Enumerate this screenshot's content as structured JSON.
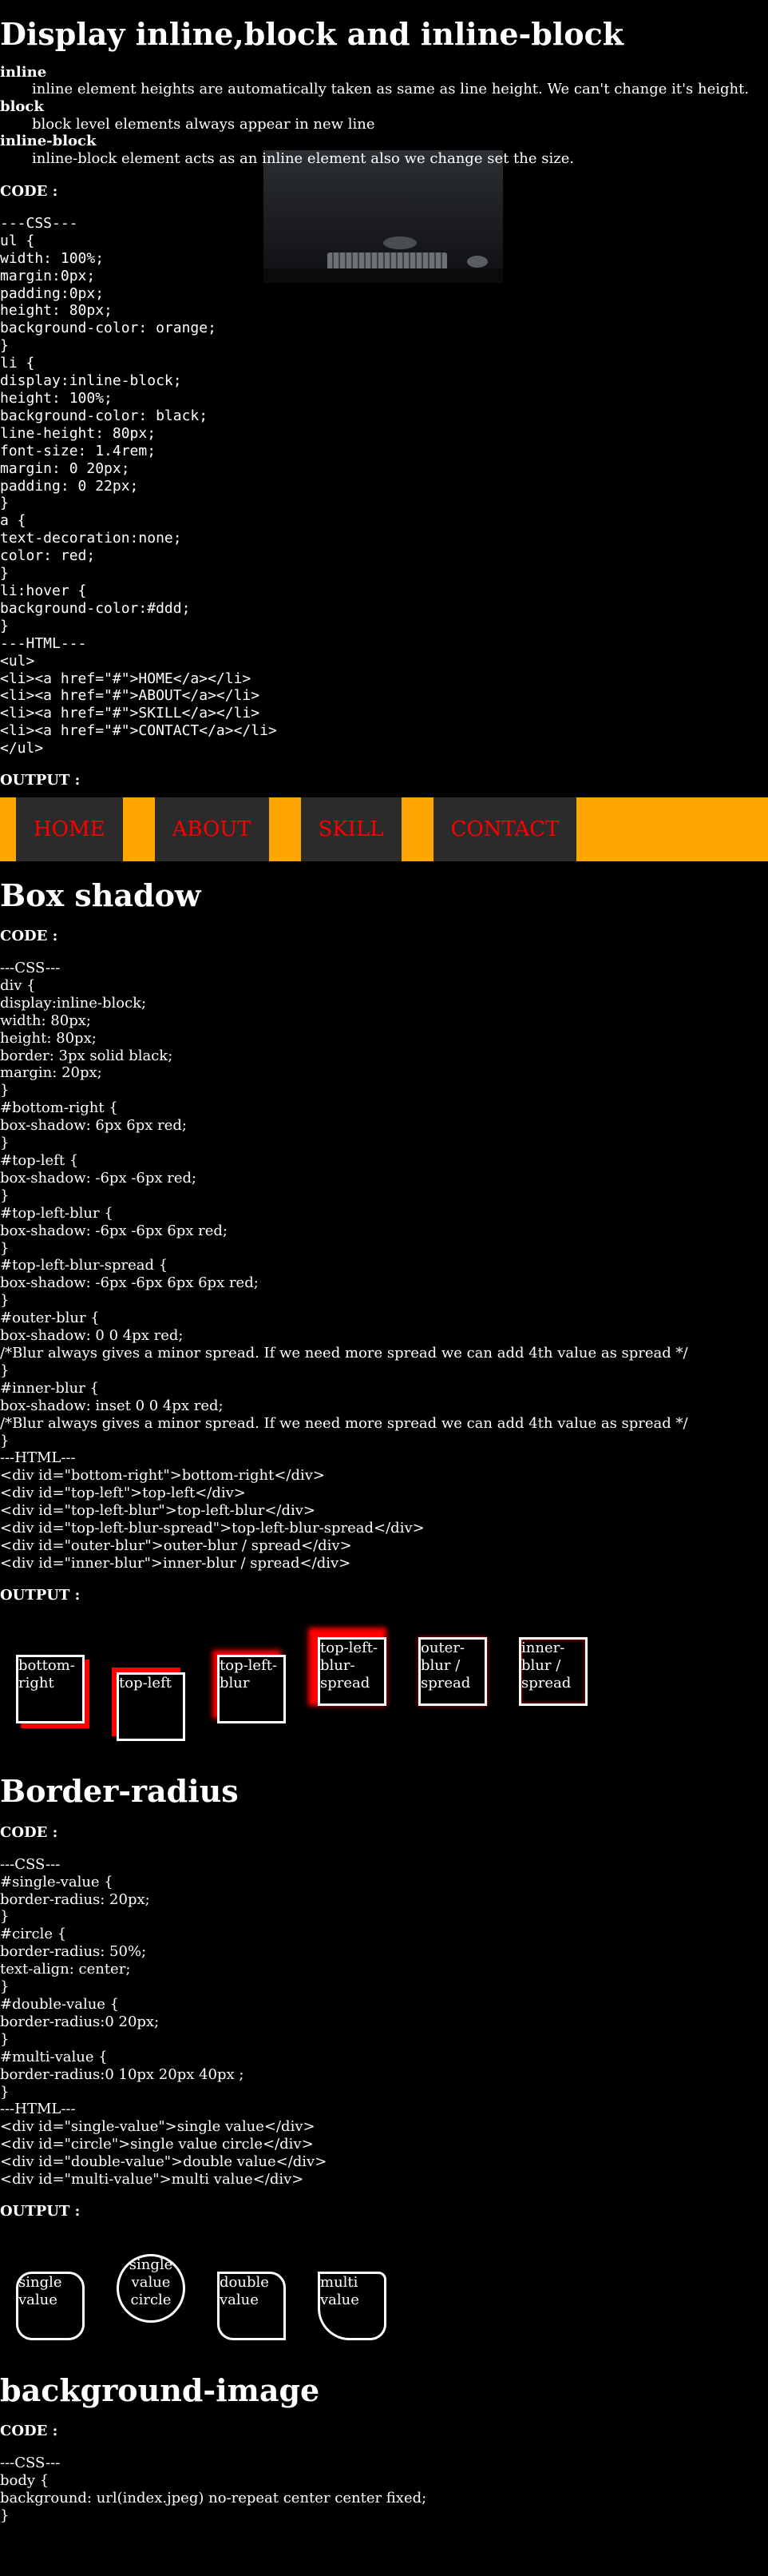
{
  "display_section": {
    "title": "Display inline,block and inline-block",
    "terms": [
      {
        "term": "inline",
        "desc": "inline element heights are automatically taken as same as line height. We can't change it's height."
      },
      {
        "term": "block",
        "desc": "block level elements always appear in new line"
      },
      {
        "term": "inline-block",
        "desc": "inline-block element acts as an inline element also we change set the size."
      }
    ],
    "code_label": "CODE :",
    "code": "---CSS---\nul {\nwidth: 100%;\nmargin:0px;\npadding:0px;\nheight: 80px;\nbackground-color: orange;\n}\nli {\ndisplay:inline-block;\nheight: 100%;\nbackground-color: black;\nline-height: 80px;\nfont-size: 1.4rem;\nmargin: 0 20px;\npadding: 0 22px;\n}\na {\ntext-decoration:none;\ncolor: red;\n}\nli:hover {\nbackground-color:#ddd;\n}\n---HTML---\n<ul>\n<li><a href=\"#\">HOME</a></li>\n<li><a href=\"#\">ABOUT</a></li>\n<li><a href=\"#\">SKILL</a></li>\n<li><a href=\"#\">CONTACT</a></li>\n</ul>",
    "output_label": "OUTPUT :",
    "nav_items": [
      "HOME",
      "ABOUT",
      "SKILL",
      "CONTACT"
    ],
    "colors": {
      "nav_bg": "#ffa500",
      "item_bg": "#2b2b2b",
      "link": "#ff0000"
    }
  },
  "box_shadow_section": {
    "title": "Box shadow",
    "code_label": "CODE :",
    "code": "---CSS---\ndiv {\ndisplay:inline-block;\nwidth: 80px;\nheight: 80px;\nborder: 3px solid black;\nmargin: 20px;\n}\n#bottom-right {\nbox-shadow: 6px 6px red;\n}\n#top-left {\nbox-shadow: -6px -6px red;\n}\n#top-left-blur {\nbox-shadow: -6px -6px 6px red;\n}\n#top-left-blur-spread {\nbox-shadow: -6px -6px 6px 6px red;\n}\n#outer-blur {\nbox-shadow: 0 0 4px red;\n/*Blur always gives a minor spread. If we need more spread we can add 4th value as spread */\n}\n#inner-blur {\nbox-shadow: inset 0 0 4px red;\n/*Blur always gives a minor spread. If we need more spread we can add 4th value as spread */\n}\n---HTML---\n<div id=\"bottom-right\">bottom-right</div>\n<div id=\"top-left\">top-left</div>\n<div id=\"top-left-blur\">top-left-blur</div>\n<div id=\"top-left-blur-spread\">top-left-blur-spread</div>\n<div id=\"outer-blur\">outer-blur / spread</div>\n<div id=\"inner-blur\">inner-blur / spread</div>",
    "output_label": "OUTPUT :",
    "boxes": [
      "bottom-right",
      "top-left",
      "top-left-blur",
      "top-left-blur-spread",
      "outer-blur / spread",
      "inner-blur / spread"
    ]
  },
  "border_radius_section": {
    "title": "Border-radius",
    "code_label": "CODE :",
    "code": "---CSS---\n#single-value {\nborder-radius: 20px;\n}\n#circle {\nborder-radius: 50%;\ntext-align: center;\n}\n#double-value {\nborder-radius:0 20px;\n}\n#multi-value {\nborder-radius:0 10px 20px 40px ;\n}\n---HTML---\n<div id=\"single-value\">single value</div>\n<div id=\"circle\">single value circle</div>\n<div id=\"double-value\">double value</div>\n<div id=\"multi-value\">multi value</div>",
    "output_label": "OUTPUT :",
    "boxes": [
      "single value",
      "single value circle",
      "double value",
      "multi value"
    ]
  },
  "background_section": {
    "title": "background-image",
    "code_label": "CODE :",
    "code": "---CSS---\nbody {\nbackground: url(index.jpeg) no-repeat center center fixed;\n}"
  }
}
